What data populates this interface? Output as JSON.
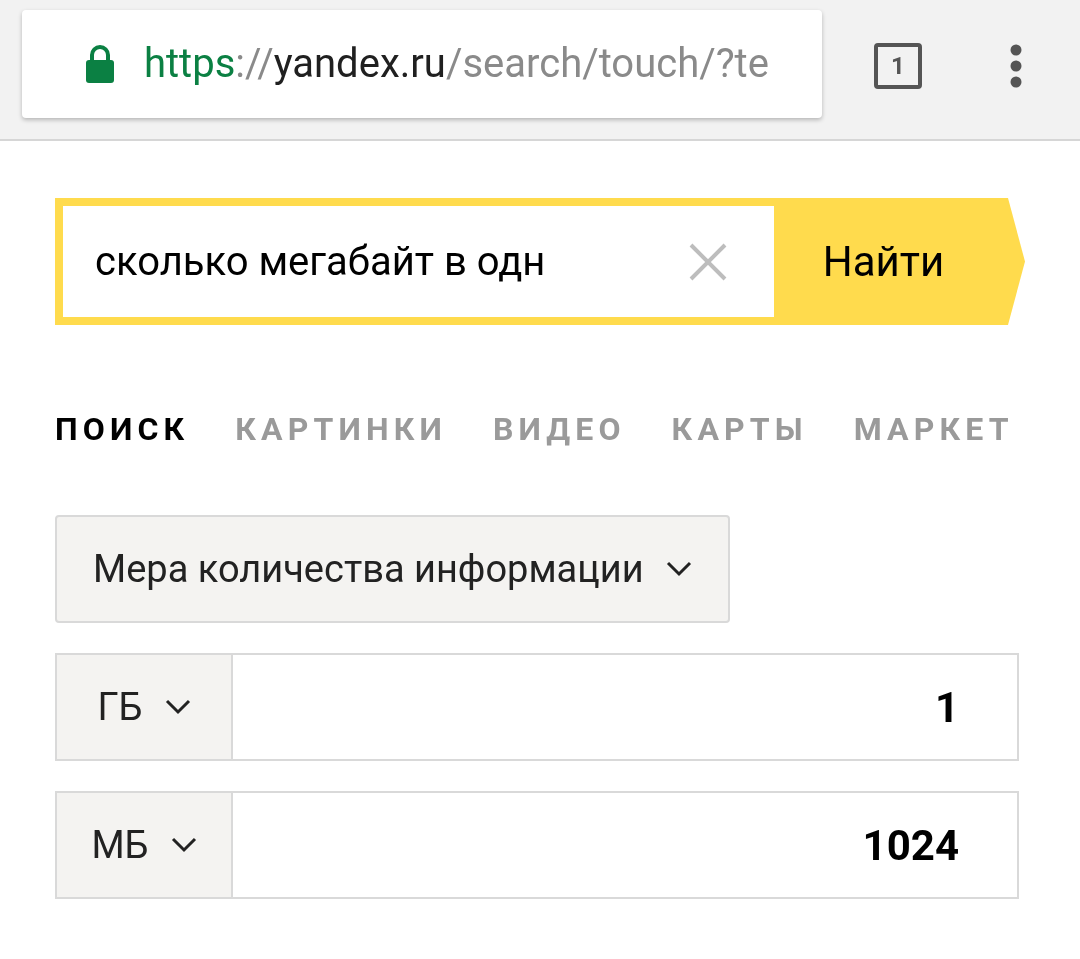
{
  "browser": {
    "url_scheme": "https",
    "url_separator": "://",
    "url_host": "yandex.ru",
    "url_path": "/search/touch/?te",
    "tab_count": "1"
  },
  "search": {
    "value": "сколько мегабайт в одн",
    "button": "Найти"
  },
  "tabs": [
    {
      "label": "ПОИСК",
      "selected": true
    },
    {
      "label": "КАРТИНКИ",
      "selected": false
    },
    {
      "label": "ВИДЕО",
      "selected": false
    },
    {
      "label": "КАРТЫ",
      "selected": false
    },
    {
      "label": "МАРКЕТ",
      "selected": false
    }
  ],
  "converter": {
    "category": "Мера количества информации",
    "rows": [
      {
        "unit": "ГБ",
        "value": "1"
      },
      {
        "unit": "МБ",
        "value": "1024"
      }
    ]
  }
}
